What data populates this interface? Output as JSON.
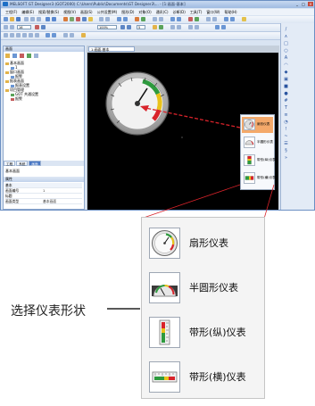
{
  "window": {
    "title": "MELSOFT GT Designer3 (GOT2000) C:\\Users\\Public\\Documents\\GT Designer3\\… - [1:画面-基本]",
    "minimize_glyph": "_",
    "maximize_glyph": "□",
    "close_glyph": "×"
  },
  "menu": [
    "工程(F)",
    "编辑(E)",
    "搜索/替换(S)",
    "视图(V)",
    "画面(S)",
    "公共设置(M)",
    "图形(D)",
    "对象(O)",
    "通讯(C)",
    "诊断(D)",
    "工具(T)",
    "窗口(W)",
    "帮助(H)"
  ],
  "toolbar": {
    "zoom_value": "100%",
    "font_value": "16",
    "extra_value": "5"
  },
  "left_panel": {
    "header": "画面",
    "tree": [
      {
        "label": "基本画面",
        "indent": 0
      },
      {
        "label": "1",
        "indent": 2
      },
      {
        "label": "窗口画面",
        "indent": 0
      },
      {
        "label": "报警",
        "indent": 2
      },
      {
        "label": "报表画面",
        "indent": 0
      },
      {
        "label": "报表设置",
        "indent": 2
      },
      {
        "label": "项目管理",
        "indent": 0
      },
      {
        "label": "GOT 共通设置",
        "indent": 2
      },
      {
        "label": "报警",
        "indent": 2
      }
    ],
    "tabs": [
      {
        "label": "工程",
        "active": false
      },
      {
        "label": "系统",
        "active": false
      },
      {
        "label": "画面",
        "active": true
      }
    ],
    "lower_title": "基本画面",
    "properties_header": "属性",
    "properties": [
      {
        "k": "基本",
        "v": ""
      },
      {
        "k": "画面编号",
        "v": "1"
      },
      {
        "k": "标题",
        "v": ""
      },
      {
        "k": "画面类型",
        "v": "基本画面"
      },
      {
        "k": "",
        "v": ""
      }
    ]
  },
  "document_tab": "1:画面-基本",
  "popup": {
    "items": [
      {
        "label": "扇形仪表",
        "selected": true
      },
      {
        "label": "半圆形仪表",
        "selected": false
      },
      {
        "label": "带形(纵)仪表",
        "selected": false
      },
      {
        "label": "带形(横)仪表",
        "selected": false
      }
    ]
  },
  "big_panel": {
    "items": [
      {
        "label": "扇形仪表"
      },
      {
        "label": "半圆形仪表"
      },
      {
        "label": "带形(纵)仪表"
      },
      {
        "label": "带形(横)仪表"
      }
    ]
  },
  "callout": {
    "text": "选择仪表形状"
  },
  "colors": {
    "accent_red": "#d8232a",
    "highlight_orange": "#f4a96a",
    "gauge_green": "#2e9a3e",
    "gauge_yellow": "#e9c21a"
  },
  "icons": [
    "app-logo-icon",
    "gauge-icon",
    "folder-icon",
    "screen-icon"
  ]
}
